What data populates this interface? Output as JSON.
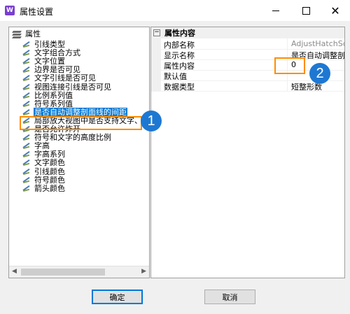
{
  "window": {
    "title": "属性设置",
    "app_icon_text": "W"
  },
  "tree": {
    "root_label": "属性",
    "items": [
      {
        "label": "引线类型"
      },
      {
        "label": "文字组合方式"
      },
      {
        "label": "文字位置"
      },
      {
        "label": "边界是否可见"
      },
      {
        "label": "文字引线是否可见"
      },
      {
        "label": "视图连接引线是否可见"
      },
      {
        "label": "比例系列值"
      },
      {
        "label": "符号系列值"
      },
      {
        "label": "是否自动调整剖面线的间距",
        "selected": true
      },
      {
        "label": "局部放大视图中是否支持文字、属"
      },
      {
        "label": "是否允许炸开"
      },
      {
        "label": "符号和文字的高度比例"
      },
      {
        "label": "字高"
      },
      {
        "label": "字高系列"
      },
      {
        "label": "文字颜色"
      },
      {
        "label": "引线颜色"
      },
      {
        "label": "符号颜色"
      },
      {
        "label": "箭头颜色"
      }
    ]
  },
  "properties": {
    "category_label": "属性内容",
    "category_toggle": "−",
    "rows": [
      {
        "name": "内部名称",
        "value": "AdjustHatchScale",
        "muted": true
      },
      {
        "name": "显示名称",
        "value": "是否自动调整剖...",
        "muted": false
      },
      {
        "name": "属性内容",
        "value": "0",
        "muted": false
      },
      {
        "name": "默认值",
        "value": "",
        "muted": false
      },
      {
        "name": "数据类型",
        "value": "短整形数",
        "muted": false
      }
    ]
  },
  "callouts": {
    "badge1": "1",
    "badge2": "2"
  },
  "buttons": {
    "ok_label": "确定",
    "cancel_label": "取消"
  },
  "icons": {
    "close": "close-icon",
    "minimize": "minimize-icon",
    "maximize": "maximize-icon"
  },
  "colors": {
    "selection": "#0078d7",
    "callout_border": "#ff8c00",
    "badge": "#1e78d2"
  }
}
